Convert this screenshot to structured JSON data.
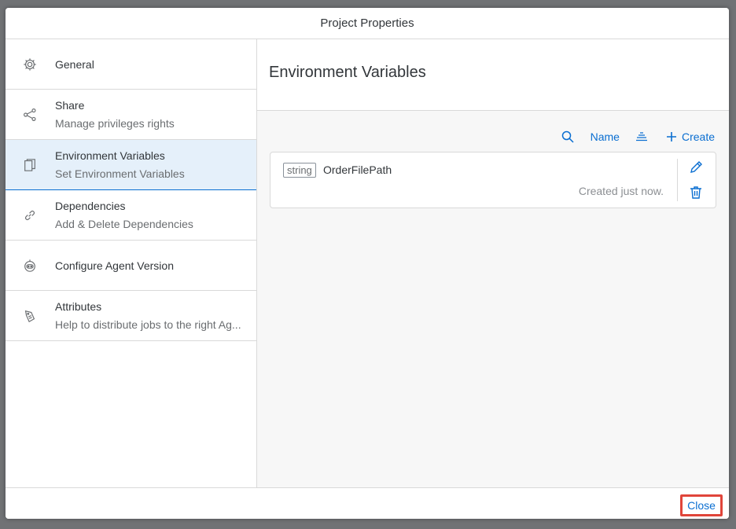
{
  "dialog": {
    "title": "Project Properties",
    "close_label": "Close"
  },
  "sidebar": {
    "items": [
      {
        "label": "General",
        "sublabel": "",
        "icon": "gear-icon"
      },
      {
        "label": "Share",
        "sublabel": "Manage privileges rights",
        "icon": "share-icon"
      },
      {
        "label": "Environment Variables",
        "sublabel": "Set Environment Variables",
        "icon": "copy-icon",
        "selected": true
      },
      {
        "label": "Dependencies",
        "sublabel": "Add & Delete Dependencies",
        "icon": "link-icon"
      },
      {
        "label": "Configure Agent Version",
        "sublabel": "",
        "icon": "robot-icon"
      },
      {
        "label": "Attributes",
        "sublabel": "Help to distribute jobs to the right Ag...",
        "icon": "tag-icon"
      }
    ]
  },
  "main": {
    "title": "Environment Variables",
    "toolbar": {
      "sort_field": "Name",
      "create_label": "Create"
    },
    "variables": [
      {
        "type": "string",
        "name": "OrderFilePath",
        "meta": "Created just now."
      }
    ]
  },
  "colors": {
    "accent": "#0a6ed1",
    "selected_bg": "#e5f0fa",
    "highlight_border": "#e0453a"
  }
}
